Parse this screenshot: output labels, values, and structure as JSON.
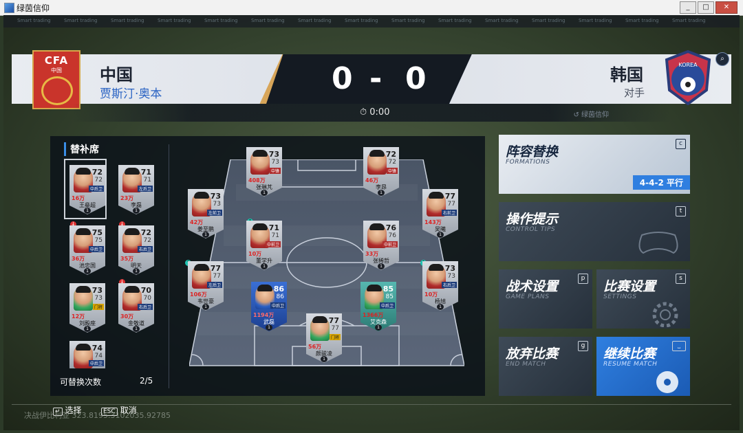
{
  "window": {
    "title": "绿茵信仰",
    "buttons": [
      "_",
      "□",
      "✕"
    ]
  },
  "ads": [
    "Smart trading",
    "Smart trading",
    "Smart trading",
    "Smart trading",
    "Smart trading",
    "Smart trading",
    "Smart trading",
    "Smart trading",
    "Smart trading",
    "Smart trading",
    "Smart trading",
    "Smart trading",
    "Smart trading",
    "Smart trading",
    "Smart trading"
  ],
  "scoreboard": {
    "home": {
      "name": "中国",
      "coach": "贾斯汀·奥本",
      "badge_text": "CFA",
      "badge_sub": "中国"
    },
    "away": {
      "name": "韩国",
      "label": "对手",
      "badge_text": "KOREA"
    },
    "home_score": "0",
    "separator": "-",
    "away_score": "0",
    "time": "0:00",
    "replay_label": "绿茵信仰"
  },
  "bench": {
    "title": "替补席",
    "subs_label": "可替换次数",
    "subs_count": "2/5",
    "players": [
      {
        "name": "王燊超",
        "r1": "72",
        "r2": "72",
        "pos": "中后卫",
        "val": "16万",
        "num": "1"
      },
      {
        "name": "李磊",
        "r1": "71",
        "r2": "71",
        "pos": "左后卫",
        "val": "23万",
        "num": "1"
      },
      {
        "name": "池忠国",
        "r1": "75",
        "r2": "75",
        "pos": "中后卫",
        "val": "36万",
        "num": "1"
      },
      {
        "name": "明天",
        "r1": "72",
        "r2": "72",
        "pos": "右后卫",
        "val": "35万",
        "num": "1"
      },
      {
        "name": "刘殿座",
        "r1": "73",
        "r2": "73",
        "pos": "门将",
        "val": "12万",
        "num": "1"
      },
      {
        "name": "金敬道",
        "r1": "70",
        "r2": "70",
        "pos": "右后卫",
        "val": "30万",
        "num": "1"
      },
      {
        "name": "",
        "r1": "74",
        "r2": "74",
        "pos": "中后卫",
        "val": "",
        "num": ""
      }
    ]
  },
  "lineup": [
    {
      "name": "张琳芃",
      "r1": "73",
      "r2": "73",
      "pos": "中锋",
      "val": "408万",
      "num": "1"
    },
    {
      "name": "李昂",
      "r1": "72",
      "r2": "72",
      "pos": "中锋",
      "val": "46万",
      "num": "1"
    },
    {
      "name": "姜至鹏",
      "r1": "73",
      "r2": "73",
      "pos": "左前卫",
      "val": "42万",
      "num": "1"
    },
    {
      "name": "吴曦",
      "r1": "77",
      "r2": "77",
      "pos": "右前卫",
      "val": "143万",
      "num": "1"
    },
    {
      "name": "董学升",
      "r1": "71",
      "r2": "71",
      "pos": "中前卫",
      "val": "10万",
      "num": "1"
    },
    {
      "name": "张稀哲",
      "r1": "76",
      "r2": "76",
      "pos": "中前卫",
      "val": "33万",
      "num": "1"
    },
    {
      "name": "韦世豪",
      "r1": "77",
      "r2": "77",
      "pos": "左后卫",
      "val": "106万",
      "num": "1"
    },
    {
      "name": "杨旭",
      "r1": "73",
      "r2": "73",
      "pos": "右后卫",
      "val": "10万",
      "num": "1"
    },
    {
      "name": "武磊",
      "r1": "86",
      "r2": "86",
      "pos": "中后卫",
      "val": "1194万",
      "num": "1"
    },
    {
      "name": "艾克森",
      "r1": "85",
      "r2": "85",
      "pos": "中后卫",
      "val": "1366万",
      "num": "1"
    },
    {
      "name": "颜骏凌",
      "r1": "77",
      "r2": "77",
      "pos": "门将",
      "val": "56万",
      "num": "1"
    }
  ],
  "menu": {
    "formations": {
      "label": "阵容替换",
      "en": "FORMATIONS",
      "key": "c",
      "formation": "4-4-2 平行"
    },
    "tips": {
      "label": "操作提示",
      "en": "CONTROL TIPS",
      "key": "t"
    },
    "tactics": {
      "label": "战术设置",
      "en": "GAME PLANS",
      "key": "p"
    },
    "settings": {
      "label": "比赛设置",
      "en": "SETTINGS",
      "key": "s"
    },
    "quit": {
      "label": "放弃比赛",
      "en": "END MATCH",
      "key": "g"
    },
    "resume": {
      "label": "继续比赛",
      "en": "RESUME MATCH",
      "key": "⎵"
    }
  },
  "hints": {
    "select_key": "↵",
    "select": "选择",
    "cancel_key": "ESC",
    "cancel": "取消"
  },
  "coords": "决战伊比利亚 323.8195.3102035.92785",
  "colors": {
    "accent_blue": "#2f7fe0",
    "home_gold": "#d7a559",
    "away_blue": "#3e74c9",
    "cfa_red": "#c9342b"
  }
}
